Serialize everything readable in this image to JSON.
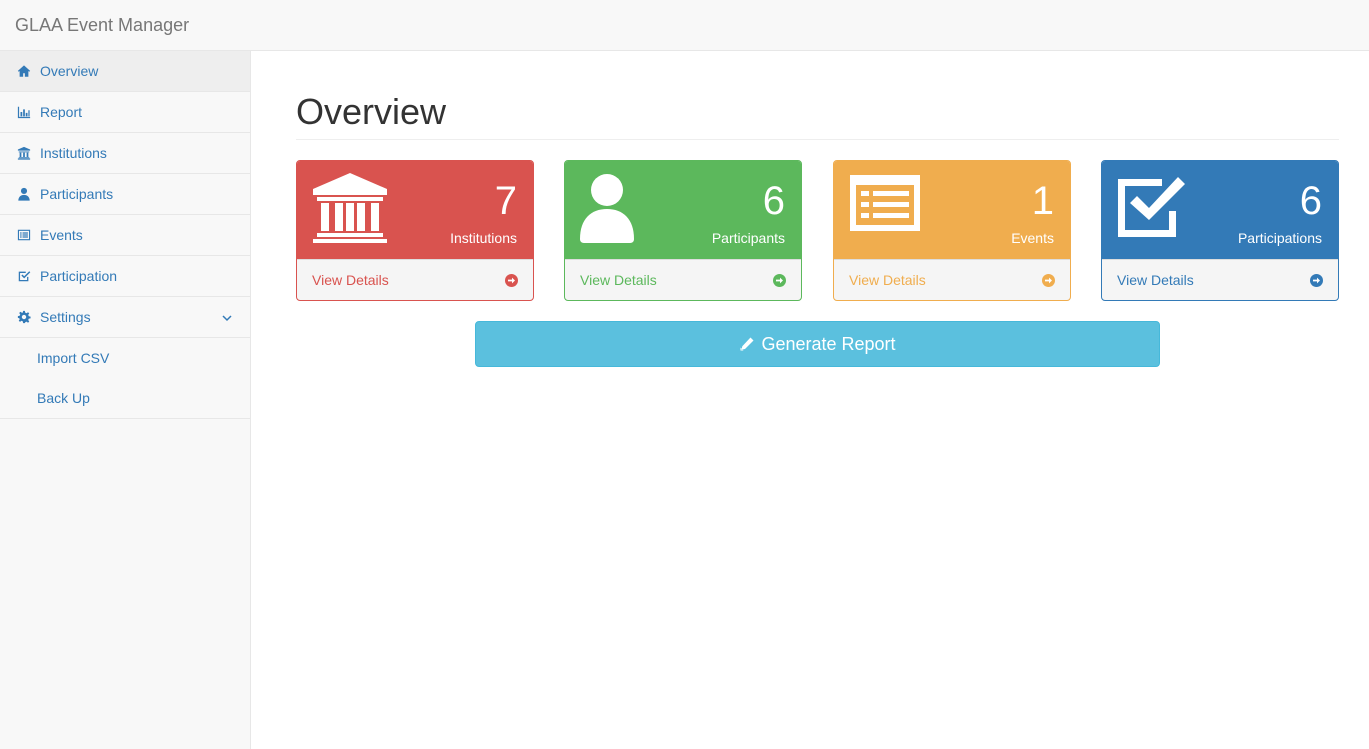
{
  "app": {
    "brand": "GLAA Event Manager"
  },
  "sidebar": {
    "items": [
      {
        "label": "Overview",
        "icon": "home-icon",
        "active": true
      },
      {
        "label": "Report",
        "icon": "bar-chart-icon"
      },
      {
        "label": "Institutions",
        "icon": "institution-icon"
      },
      {
        "label": "Participants",
        "icon": "user-icon"
      },
      {
        "label": "Events",
        "icon": "list-alt-icon"
      },
      {
        "label": "Participation",
        "icon": "check-square-icon"
      },
      {
        "label": "Settings",
        "icon": "gear-icon",
        "expanded": true
      }
    ],
    "settings_sub": [
      "Import CSV",
      "Back Up"
    ]
  },
  "main": {
    "title": "Overview",
    "panels": [
      {
        "count": "7",
        "label": "Institutions",
        "link": "View Details",
        "color": "#d9534f",
        "icon": "institution-icon"
      },
      {
        "count": "6",
        "label": "Participants",
        "link": "View Details",
        "color": "#5cb85c",
        "icon": "user-icon"
      },
      {
        "count": "1",
        "label": "Events",
        "link": "View Details",
        "color": "#f0ad4e",
        "icon": "list-alt-icon"
      },
      {
        "count": "6",
        "label": "Participations",
        "link": "View Details",
        "color": "#337ab7",
        "icon": "check-square-icon"
      }
    ],
    "generate_label": "Generate Report"
  }
}
